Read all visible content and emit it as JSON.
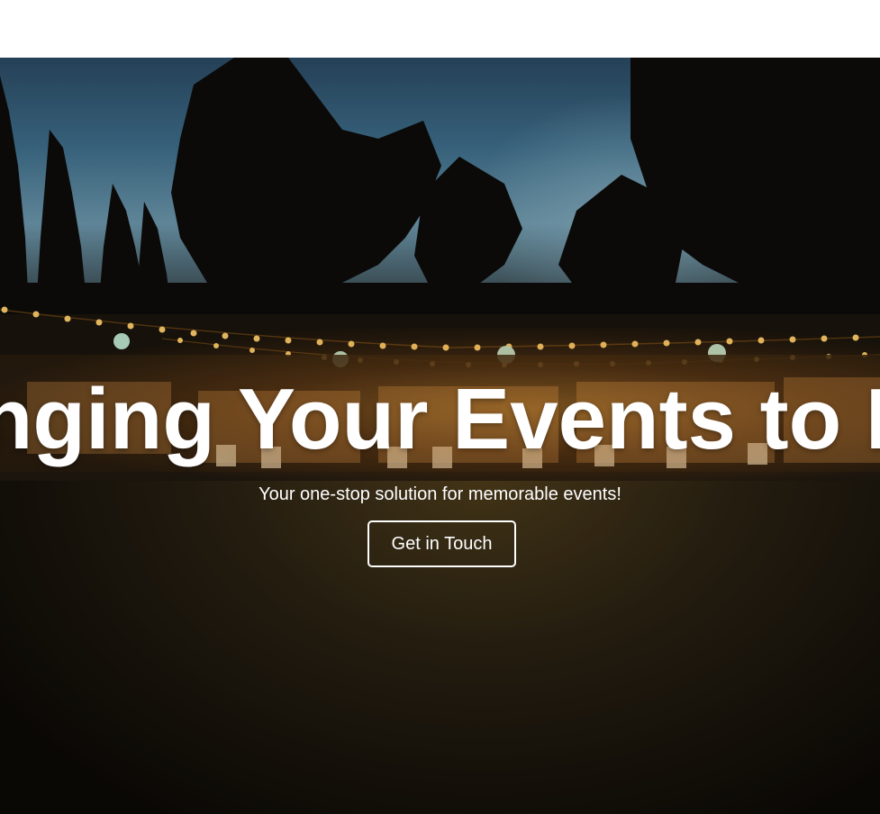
{
  "hero": {
    "headline": "Bringing Your Events to Life",
    "subtitle": "Your one-stop solution for memorable events!",
    "cta_label": "Get in Touch"
  },
  "colors": {
    "text": "#ffffff",
    "topbar": "#ffffff",
    "light_warm": "#ffb347"
  }
}
